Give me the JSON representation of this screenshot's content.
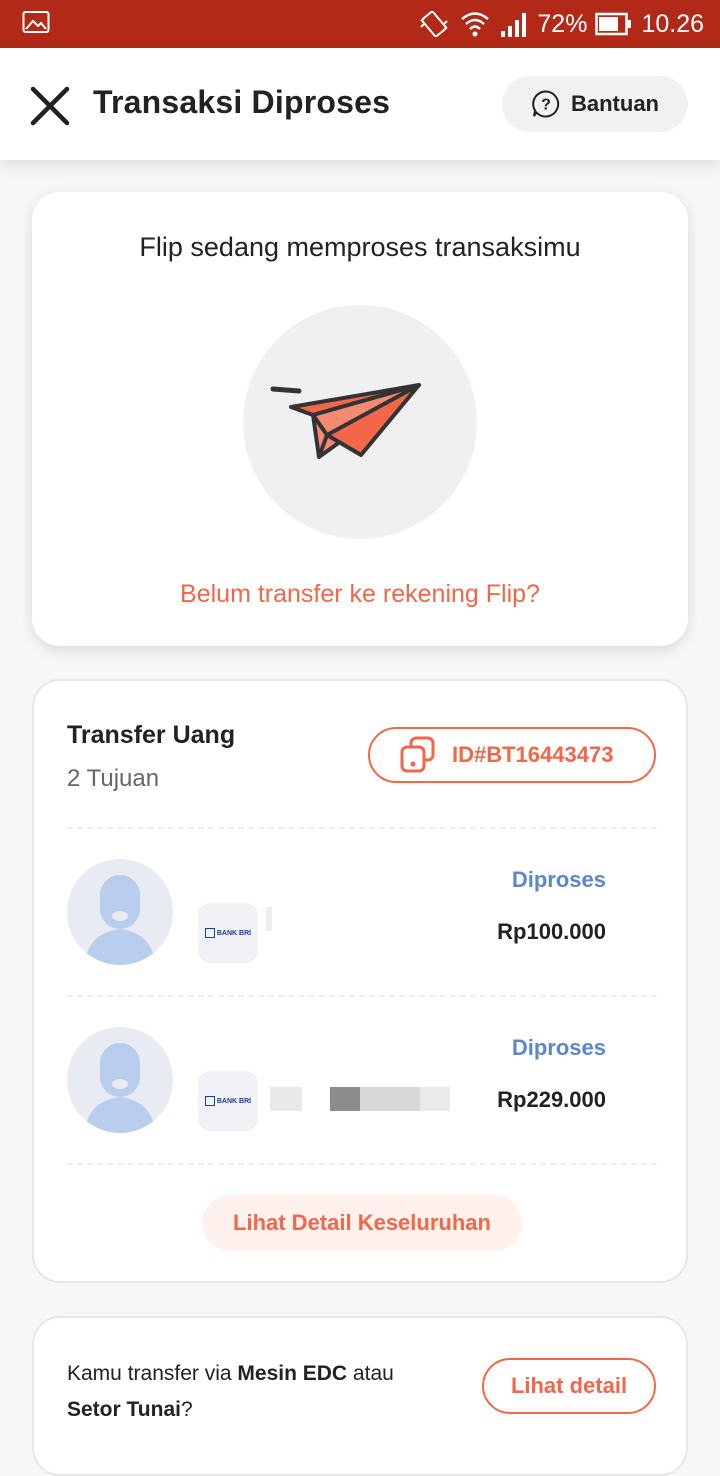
{
  "status_bar": {
    "battery": "72%",
    "time": "10.26",
    "icons": [
      "image-icon",
      "vibrate-icon",
      "wifi-icon",
      "signal-icon",
      "battery-icon"
    ]
  },
  "header": {
    "title": "Transaksi Diproses",
    "help_label": "Bantuan",
    "icons": [
      "close-icon",
      "help-icon"
    ]
  },
  "status_card": {
    "heading": "Flip sedang memproses transaksimu",
    "link": "Belum transfer ke rekening Flip?",
    "illustration": "paper-plane-icon"
  },
  "transfer": {
    "title": "Transfer Uang",
    "subtitle": "2 Tujuan",
    "id": "ID#BT16443473",
    "recipients": [
      {
        "bank": "BANK BRI",
        "status": "Diproses",
        "amount": "Rp100.000"
      },
      {
        "bank": "BANK BRI",
        "status": "Diproses",
        "amount": "Rp229.000"
      }
    ],
    "detail_button": "Lihat Detail Keseluruhan"
  },
  "edc": {
    "text_1": "Kamu transfer via ",
    "bold_1": "Mesin EDC",
    "text_2": " atau",
    "bold_2": "Setor Tunai",
    "text_3": "?",
    "button": "Lihat detail"
  },
  "colors": {
    "status_bar": "#b22a17",
    "accent": "#f2664a",
    "status_blue": "#5f86c9"
  }
}
